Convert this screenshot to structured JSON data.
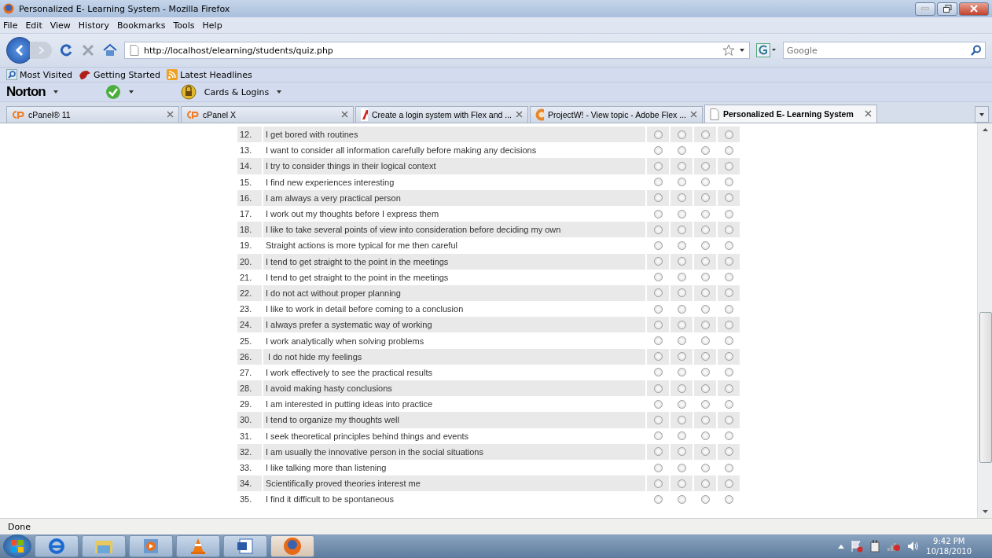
{
  "window": {
    "title": "Personalized E- Learning System - Mozilla Firefox"
  },
  "menu": [
    "File",
    "Edit",
    "View",
    "History",
    "Bookmarks",
    "Tools",
    "Help"
  ],
  "navigation": {
    "url": "http://localhost/elearning/students/quiz.php",
    "search_placeholder": "Google"
  },
  "bookmarks": [
    "Most Visited",
    "Getting Started",
    "Latest Headlines"
  ],
  "norton": {
    "brand": "Norton",
    "cards": "Cards & Logins"
  },
  "tabs": [
    {
      "label": "cPanel® 11",
      "selected": false
    },
    {
      "label": "cPanel X",
      "selected": false
    },
    {
      "label": "Create a login system with Flex and ...",
      "selected": false
    },
    {
      "label": "ProjectW! - View topic - Adobe Flex ...",
      "selected": false
    },
    {
      "label": "Personalized E- Learning System",
      "selected": true
    }
  ],
  "questions": [
    {
      "number": "12.",
      "text": "I get bored with routines",
      "choices": [
        false,
        false,
        false,
        false
      ]
    },
    {
      "number": "13.",
      "text": "I want to consider all information carefully before making any decisions",
      "choices": [
        false,
        false,
        false,
        false
      ]
    },
    {
      "number": "14.",
      "text": "I try to consider things in their logical context",
      "choices": [
        false,
        false,
        false,
        false
      ]
    },
    {
      "number": "15.",
      "text": "I find new experiences interesting",
      "choices": [
        false,
        false,
        false,
        false
      ]
    },
    {
      "number": "16.",
      "text": "I am always a very practical person",
      "choices": [
        false,
        false,
        false,
        false
      ]
    },
    {
      "number": "17.",
      "text": "I work out my thoughts before I express them",
      "choices": [
        false,
        false,
        false,
        false
      ]
    },
    {
      "number": "18.",
      "text": "I like to take several points of view into consideration before deciding my own",
      "choices": [
        false,
        false,
        false,
        false
      ]
    },
    {
      "number": "19.",
      "text": "Straight actions is more typical for me then careful",
      "choices": [
        false,
        false,
        false,
        false
      ]
    },
    {
      "number": "20.",
      "text": "I tend to get straight to the point in the meetings",
      "choices": [
        false,
        false,
        false,
        false
      ]
    },
    {
      "number": "21.",
      "text": "I tend to get straight to the point in the meetings",
      "choices": [
        false,
        false,
        false,
        false
      ]
    },
    {
      "number": "22.",
      "text": "I do not act without proper planning",
      "choices": [
        false,
        false,
        false,
        false
      ]
    },
    {
      "number": "23.",
      "text": "I like to work in detail before coming to a conclusion",
      "choices": [
        false,
        false,
        false,
        false
      ]
    },
    {
      "number": "24.",
      "text": "I always prefer a systematic way of working",
      "choices": [
        false,
        false,
        false,
        false
      ]
    },
    {
      "number": "25.",
      "text": "I work analytically when solving problems",
      "choices": [
        false,
        false,
        false,
        false
      ]
    },
    {
      "number": "26.",
      "text": " I do not hide my feelings",
      "choices": [
        false,
        false,
        false,
        false
      ]
    },
    {
      "number": "27.",
      "text": "I work effectively to see the practical results",
      "choices": [
        false,
        false,
        false,
        false
      ]
    },
    {
      "number": "28.",
      "text": "I avoid making hasty conclusions",
      "choices": [
        false,
        false,
        false,
        false
      ]
    },
    {
      "number": "29.",
      "text": "I am interested in putting ideas into practice",
      "choices": [
        false,
        false,
        false,
        false
      ]
    },
    {
      "number": "30.",
      "text": "I tend to organize my thoughts well",
      "choices": [
        false,
        false,
        false,
        false
      ]
    },
    {
      "number": "31.",
      "text": "I seek theoretical principles behind things and events",
      "choices": [
        false,
        false,
        false,
        false
      ]
    },
    {
      "number": "32.",
      "text": "I am usually the innovative person in the social situations",
      "choices": [
        false,
        false,
        false,
        false
      ]
    },
    {
      "number": "33.",
      "text": "I like talking more than listening",
      "choices": [
        false,
        false,
        false,
        false
      ]
    },
    {
      "number": "34.",
      "text": "Scientifically proved theories interest me",
      "choices": [
        false,
        false,
        false,
        false
      ]
    },
    {
      "number": "35.",
      "text": "I find it difficult to be spontaneous",
      "choices": [
        false,
        false,
        false,
        false
      ]
    }
  ],
  "status_bar": "Done",
  "taskbar": {
    "time": "9:42 PM",
    "date": "10/18/2010"
  }
}
